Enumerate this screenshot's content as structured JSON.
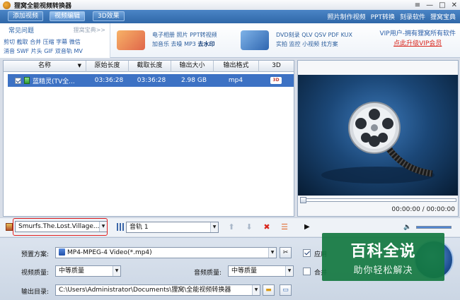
{
  "window": {
    "title": "狸窝全能视频转换器",
    "controls": [
      "≡",
      "—",
      "□",
      "✕"
    ]
  },
  "menubar": {
    "tabs": [
      {
        "label": "添加视频",
        "active": false
      },
      {
        "label": "视频编辑",
        "active": true
      },
      {
        "label": "3D效果",
        "active": false
      }
    ],
    "links": [
      "照片制作视频",
      "PPT转换",
      "刻录软件",
      "狸窝宝典"
    ]
  },
  "banner": {
    "faq_title": "常见问题",
    "faq_more": "狸窝宝典>>",
    "faq_line1": "剪切 截取 合并 压缩 字幕 微信",
    "faq_line2": "消音 SWF 片头 GIF 双音轨 MV",
    "promo1_line1": "电子相册 照片 PPT转视频",
    "promo1_line2": "加音乐 去噪 MP3",
    "promo1_emph": "去水印",
    "promo2_line1": "DVD刻录 QLV QSV PDF KUX",
    "promo2_line2": "实拍 监控 小视频 找方案",
    "vip_line": "VIP用户-拥有狸窝所有软件",
    "vip_link": "点此升级VIP会员"
  },
  "table": {
    "columns": [
      "名称",
      "原始长度",
      "截取长度",
      "输出大小",
      "输出格式",
      "3D"
    ],
    "rows": [
      {
        "name": "蓝精灵(TV全...",
        "original": "03:36:28",
        "clip": "03:36:28",
        "size": "2.98 GB",
        "format": "mp4",
        "badge": "3D"
      }
    ]
  },
  "player": {
    "timecode": "00:00:00 / 00:00:00"
  },
  "toolbar": {
    "subtitle_value": "Smurfs.The.Lost.Village...",
    "audio_track": "音轨 1"
  },
  "settings": {
    "preset_label": "预置方案:",
    "preset_value": "MP4-MPEG-4 Video(*.mp4)",
    "video_quality_label": "视频质量:",
    "video_quality_value": "中等质量",
    "audio_quality_label": "音频质量:",
    "audio_quality_value": "中等质量",
    "output_label": "输出目录:",
    "output_value": "C:\\Users\\Administrator\\Documents\\狸窝\\全能视频转换器",
    "apply_label": "应用",
    "merge_label": "合并"
  },
  "watermark": {
    "line1": "百科全说",
    "line2": "助你轻松解决"
  },
  "colors": {
    "menubar": "#3a74b8",
    "selection": "#3d72c4",
    "watermark": "#147840",
    "vip_link": "#d9261c"
  }
}
